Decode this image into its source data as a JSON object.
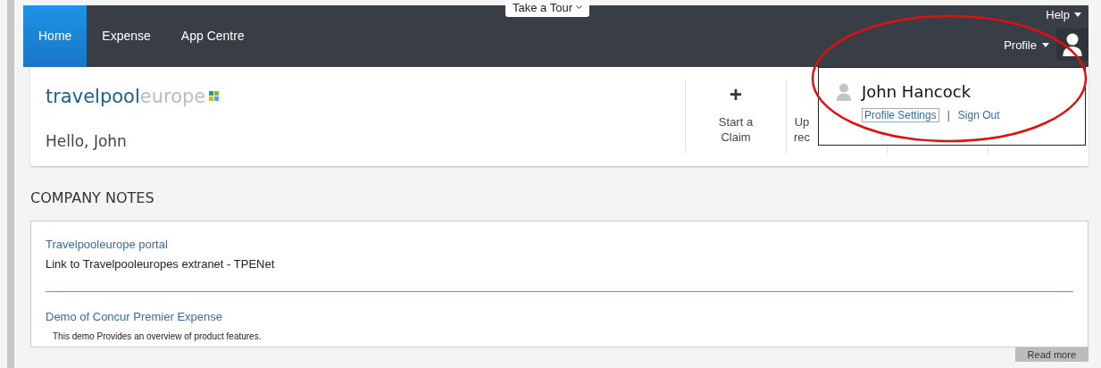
{
  "nav": {
    "tabs": [
      {
        "label": "Home",
        "selected": true
      },
      {
        "label": "Expense",
        "selected": false
      },
      {
        "label": "App Centre",
        "selected": false
      }
    ],
    "tour": "Take a Tour",
    "help": "Help",
    "profile": "Profile"
  },
  "header": {
    "logo_main": "travelpool",
    "logo_accent": "europe",
    "greeting": "Hello, John",
    "tiles": [
      {
        "icon": "+",
        "lines": [
          "Start a",
          "Claim"
        ]
      },
      {
        "lines": [
          "Up",
          "rec"
        ]
      }
    ]
  },
  "profile_menu": {
    "name": "John Hancock",
    "settings": "Profile Settings",
    "separator": "|",
    "sign_out": "Sign Out"
  },
  "notes": {
    "title": "COMPANY NOTES",
    "items": [
      {
        "link": "Travelpooleurope portal",
        "text": "Link to Travelpooleuropes extranet - TPENet"
      },
      {
        "link": "Demo of Concur Premier Expense",
        "text": "This demo Provides an overview of product features."
      }
    ],
    "read_more": "Read more"
  }
}
